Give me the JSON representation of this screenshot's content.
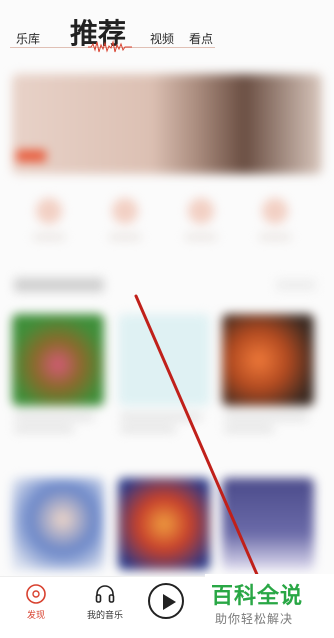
{
  "header": {
    "tabs": [
      {
        "label": "乐库"
      },
      {
        "label": "推荐"
      },
      {
        "label": "视频"
      },
      {
        "label": "看点"
      }
    ],
    "active_tab": "推荐",
    "accent": "#d8412f"
  },
  "bottom_nav": {
    "items": [
      {
        "label": "发现",
        "icon": "disc-icon",
        "active": true
      },
      {
        "label": "我的音乐",
        "icon": "headphones-icon",
        "active": false
      }
    ],
    "play_icon": "play-icon"
  },
  "watermark": {
    "title": "百科全说",
    "subtitle": "助你轻松解决",
    "color": "#29a745"
  },
  "annotation": {
    "color": "#c0201a"
  }
}
